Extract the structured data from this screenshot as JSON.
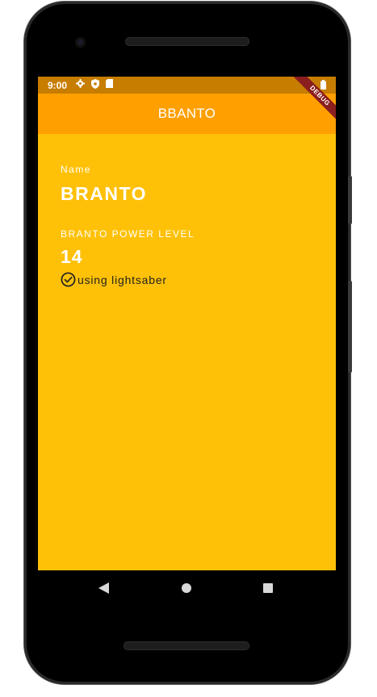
{
  "status_bar": {
    "time": "9:00",
    "left_icons": [
      "gear-icon",
      "shield-icon",
      "sd-card-icon"
    ],
    "right_icons": [
      "wifi-icon",
      "battery-icon"
    ]
  },
  "app_bar": {
    "title": "BBANTO"
  },
  "debug_banner": "DEBUG",
  "profile": {
    "name_label": "Name",
    "name_value": "BRANTO",
    "power_label": "BRANTO POWER LEVEL",
    "power_value": "14",
    "equipment_text": "using lightsaber"
  },
  "colors": {
    "screen_bg": "#FFC107",
    "app_bar_bg": "#FF9F00",
    "status_bar_bg": "#C77D00"
  },
  "nav_bar": {
    "buttons": [
      "back-icon",
      "home-icon",
      "recents-icon"
    ]
  }
}
